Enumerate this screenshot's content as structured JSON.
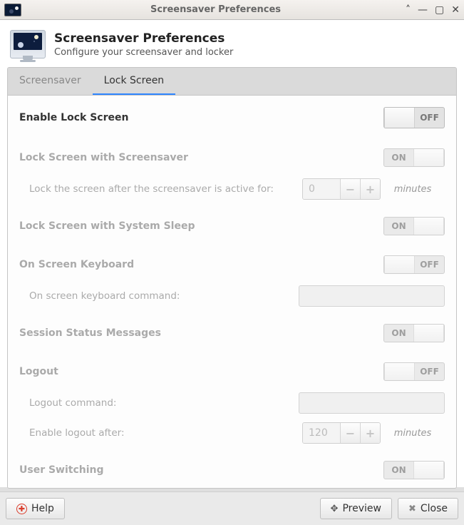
{
  "titlebar": {
    "title": "Screensaver Preferences"
  },
  "header": {
    "title": "Screensaver Preferences",
    "subtitle": "Configure your screensaver and locker"
  },
  "tabs": {
    "screensaver": "Screensaver",
    "lock": "Lock Screen"
  },
  "toggles": {
    "on": "ON",
    "off": "OFF"
  },
  "lock": {
    "enable": {
      "label": "Enable Lock Screen",
      "state": "off"
    },
    "with_screensaver": {
      "label": "Lock Screen with Screensaver",
      "state": "on",
      "delay_label": "Lock the screen after the screensaver is active for:",
      "delay_value": "0",
      "delay_unit": "minutes"
    },
    "with_sleep": {
      "label": "Lock Screen with System Sleep",
      "state": "on"
    },
    "osk": {
      "label": "On Screen Keyboard",
      "state": "off",
      "cmd_label": "On screen keyboard command:"
    },
    "session_msgs": {
      "label": "Session Status Messages",
      "state": "on"
    },
    "logout": {
      "label": "Logout",
      "state": "off",
      "cmd_label": "Logout command:",
      "enable_after_label": "Enable logout after:",
      "enable_after_value": "120",
      "enable_after_unit": "minutes"
    },
    "user_switch": {
      "label": "User Switching",
      "state": "on"
    }
  },
  "buttons": {
    "help": "Help",
    "preview": "Preview",
    "close": "Close"
  }
}
